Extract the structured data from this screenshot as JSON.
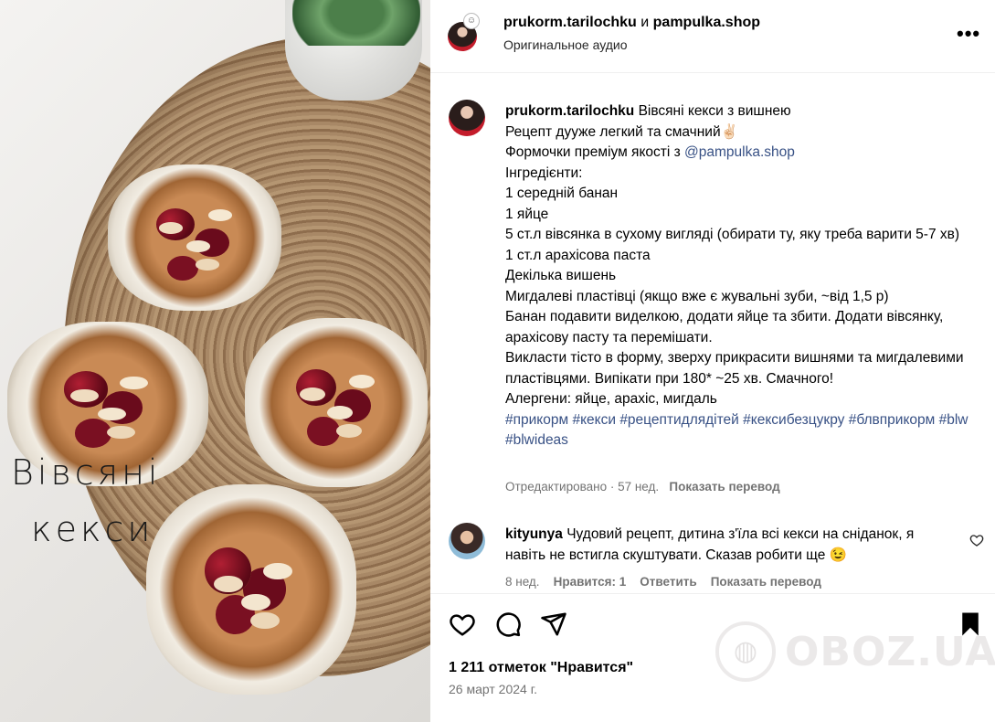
{
  "overlay": {
    "line1": "Вівсяні",
    "line2": "кекси"
  },
  "header": {
    "title_user1": "prukorm.tarilochku",
    "title_and": "и",
    "title_user2": "pampulka.shop",
    "subtitle": "Оригинальное аудио",
    "more_glyph": "•••"
  },
  "caption": {
    "user": "prukorm.tarilochku",
    "title": "Вівсяні кекси з вишнею",
    "line1": "Рецепт дууже легкий та смачний",
    "line1_emoji": "✌🏻",
    "line2_prefix": "Формочки преміум якості з ",
    "line2_link": "@pampulka.shop",
    "line3": "Інгредієнти:",
    "line4": "1 середній банан",
    "line5": "1 яйце",
    "line6": "5 ст.л вівсянка в сухому вигляді (обирати ту, яку треба варити 5-7 хв)",
    "line7": "1 ст.л арахісова паста",
    "line8": "Декілька вишень",
    "line9": "Мигдалеві пластівці (якщо вже є жувальні зуби, ~від 1,5 р)",
    "line10": "Банан подавити виделкою, додати яйце та збити. Додати вівсянку, арахісову пасту та перемішати.",
    "line11": "Викласти тісто в форму, зверху прикрасити вишнями та мигдалевими пластівцями. Випікати при 180* ~25 хв. Смачного!",
    "line12": "Алергени: яйце, арахіс, мигдаль",
    "hashtags": "#прикорм #кекси #рецептидлядітей #кексибезцукру #блвприкорм #blw #blwideas",
    "edited": "Отредактировано · 57 нед.",
    "translate": "Показать перевод"
  },
  "comment": {
    "user": "kityunya",
    "text": "Чудовий рецепт, дитина з'їла всі кекси на сніданок, я навіть не встигла скуштувати. Сказав робити ще 😉",
    "time": "8 нед.",
    "likes": "Нравится: 1",
    "reply": "Ответить",
    "translate": "Показать перевод"
  },
  "footer": {
    "likes": "1 211 отметок \"Нравится\"",
    "date": "26 март 2024 г."
  },
  "watermark": {
    "text": "OBOZ.UA"
  }
}
